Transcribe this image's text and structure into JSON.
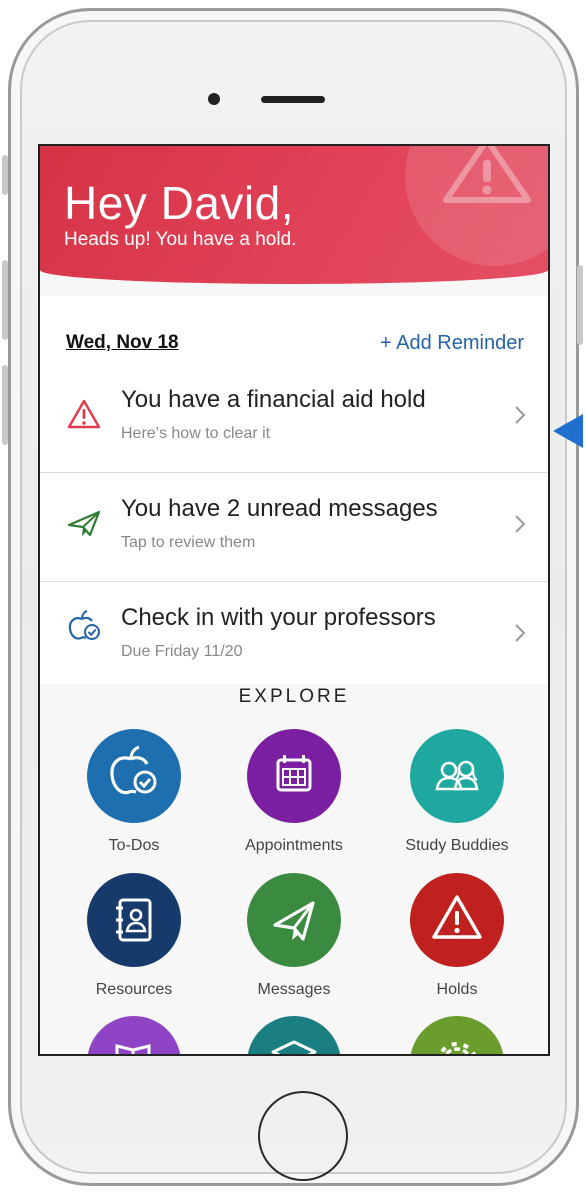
{
  "hero": {
    "title": "Hey David,",
    "subtitle": "Heads up! You have a hold."
  },
  "schedule": {
    "date": "Wed, Nov 18",
    "add_reminder": "+ Add Reminder",
    "items": [
      {
        "title": "You have a financial aid hold",
        "subtitle": "Here’s how to clear it",
        "icon": "warning-icon",
        "color": "#e23a4b"
      },
      {
        "title": "You have 2 unread messages",
        "subtitle": "Tap to review them",
        "icon": "paper-plane-icon",
        "color": "#2e7d32"
      },
      {
        "title": "Check in with your professors",
        "subtitle": "Due Friday 11/20",
        "icon": "apple-check-icon",
        "color": "#2563a8"
      }
    ]
  },
  "explore": {
    "heading": "EXPLORE",
    "tiles": [
      {
        "label": "To-Dos",
        "icon": "apple-check-icon",
        "color": "#1e6fb0"
      },
      {
        "label": "Appointments",
        "icon": "calendar-icon",
        "color": "#7b1fa2"
      },
      {
        "label": "Study Buddies",
        "icon": "people-icon",
        "color": "#1fa8a0"
      },
      {
        "label": "Resources",
        "icon": "address-book-icon",
        "color": "#163a6b"
      },
      {
        "label": "Messages",
        "icon": "paper-plane-icon",
        "color": "#3a8a3f"
      },
      {
        "label": "Holds",
        "icon": "warning-icon",
        "color": "#c0211f"
      },
      {
        "label": "",
        "icon": "book-icon",
        "color": "#8e44c5"
      },
      {
        "label": "",
        "icon": "graduation-cap-icon",
        "color": "#1a7f80"
      },
      {
        "label": "",
        "icon": "gear-icon",
        "color": "#6a9d2c"
      }
    ]
  },
  "colors": {
    "hero_red": "#d63345",
    "link_blue": "#2563a8",
    "pointer_arrow": "#1f6fcf"
  }
}
